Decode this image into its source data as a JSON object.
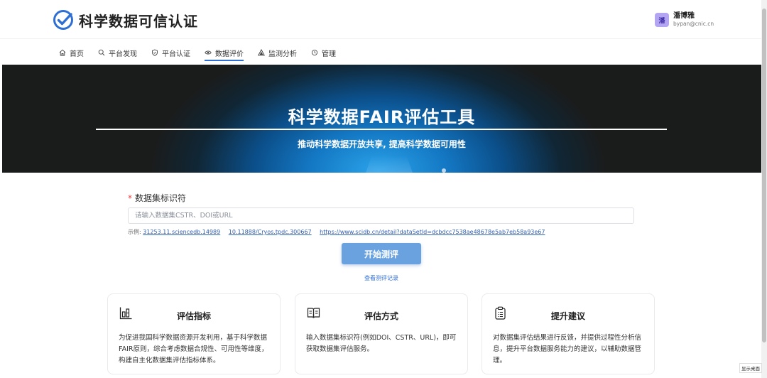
{
  "app": {
    "title": "科学数据可信认证",
    "brand_color": "#2f6fd3"
  },
  "user": {
    "avatar_text": "潘",
    "name": "潘博雅",
    "email": "bypan@cnic.cn"
  },
  "nav": {
    "items": [
      {
        "label": "首页",
        "icon": "home-icon"
      },
      {
        "label": "平台发现",
        "icon": "search-icon"
      },
      {
        "label": "平台认证",
        "icon": "shield-icon"
      },
      {
        "label": "数据评价",
        "icon": "eye-icon",
        "active": true
      },
      {
        "label": "监测分析",
        "icon": "triangle-icon"
      },
      {
        "label": "管理",
        "icon": "settings-icon"
      }
    ]
  },
  "hero": {
    "title": "科学数据FAIR评估工具",
    "subtitle": "推动科学数据开放共享, 提高科学数据可用性"
  },
  "form": {
    "required_mark": "*",
    "label": "数据集标识符",
    "placeholder": "请输入数据集CSTR、DOI或URL",
    "value": "",
    "examples_prefix": "示例:",
    "examples": [
      "31253.11.sciencedb.14989",
      "10.11888/Cryos.tpdc.300667",
      "https://www.scidb.cn/detail?dataSetId=dcbdcc7538ae48678e5ab7eb58a93e67"
    ],
    "start_button": "开始测评",
    "history_link": "查看测评记录"
  },
  "cards": [
    {
      "icon": "chart-icon",
      "title": "评估指标",
      "text": "为促进我国科学数据资源开发利用，基于科学数据FAIR原则，综合考虑数据合规性、可用性等维度，构建自主化数据集评估指标体系。"
    },
    {
      "icon": "book-icon",
      "title": "评估方式",
      "text": "输入数据集标识符(例如DOI、CSTR、URL)，即可获取数据集评估服务。"
    },
    {
      "icon": "clipboard-icon",
      "title": "提升建议",
      "text": "对数据集评估结果进行反馈，并提供过程性分析信息，提升平台数据服务能力的建议，以辅助数据管理。"
    }
  ],
  "desktop_tip": "显示桌面"
}
